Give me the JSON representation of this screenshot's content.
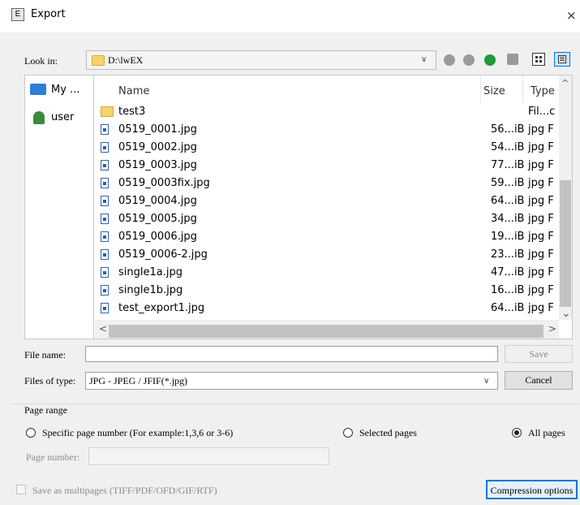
{
  "window": {
    "title": "Export",
    "close": "×",
    "app_icon": "E"
  },
  "lookin": {
    "label": "Look in:",
    "path": "D:\\lwEX"
  },
  "sidebar": {
    "items": [
      {
        "label": "My ...",
        "icon": "computer-icon"
      },
      {
        "label": "user",
        "icon": "user-icon"
      }
    ]
  },
  "list": {
    "columns": {
      "name": "Name",
      "size": "Size",
      "type": "Type"
    },
    "rows": [
      {
        "name": "test3",
        "size": "",
        "type": "Fil...c",
        "kind": "folder"
      },
      {
        "name": "0519_0001.jpg",
        "size": "56...iB",
        "type": "jpg F",
        "kind": "file"
      },
      {
        "name": "0519_0002.jpg",
        "size": "54...iB",
        "type": "jpg F",
        "kind": "file"
      },
      {
        "name": "0519_0003.jpg",
        "size": "77...iB",
        "type": "jpg F",
        "kind": "file"
      },
      {
        "name": "0519_0003fix.jpg",
        "size": "59...iB",
        "type": "jpg F",
        "kind": "file"
      },
      {
        "name": "0519_0004.jpg",
        "size": "64...iB",
        "type": "jpg F",
        "kind": "file"
      },
      {
        "name": "0519_0005.jpg",
        "size": "34...iB",
        "type": "jpg F",
        "kind": "file"
      },
      {
        "name": "0519_0006.jpg",
        "size": "19...iB",
        "type": "jpg F",
        "kind": "file"
      },
      {
        "name": "0519_0006-2.jpg",
        "size": "23...iB",
        "type": "jpg F",
        "kind": "file"
      },
      {
        "name": "single1a.jpg",
        "size": "47...iB",
        "type": "jpg F",
        "kind": "file"
      },
      {
        "name": "single1b.jpg",
        "size": "16...iB",
        "type": "jpg F",
        "kind": "file"
      },
      {
        "name": "test_export1.jpg",
        "size": "64...iB",
        "type": "jpg F",
        "kind": "file"
      }
    ]
  },
  "filename": {
    "label": "File name:",
    "value": "",
    "save_label": "Save"
  },
  "filetype": {
    "label": "Files of type:",
    "value": "JPG - JPEG / JFIF(*.jpg)",
    "cancel_label": "Cancel"
  },
  "page_range": {
    "label": "Page range",
    "specific": "Specific page number (For example:1,3,6 or 3-6)",
    "selected": "Selected pages",
    "all": "All pages",
    "checked": "all",
    "page_number_label": "Page number:",
    "page_number_value": ""
  },
  "multipage": {
    "label": "Save as multipages (TIFF/PDF/OFD/GIF/RTF)",
    "checked": false
  },
  "compression_label": "Compression options",
  "glyphs": {
    "chevron_down": "∨",
    "sort_up": "^",
    "arrow_left": "<",
    "arrow_right": ">",
    "scroll_up": "^",
    "scroll_down": "⌄"
  },
  "colors": {
    "folder": "#f6d36b",
    "nav_up": "#1f9b3a",
    "accent_border": "#0078d7"
  }
}
